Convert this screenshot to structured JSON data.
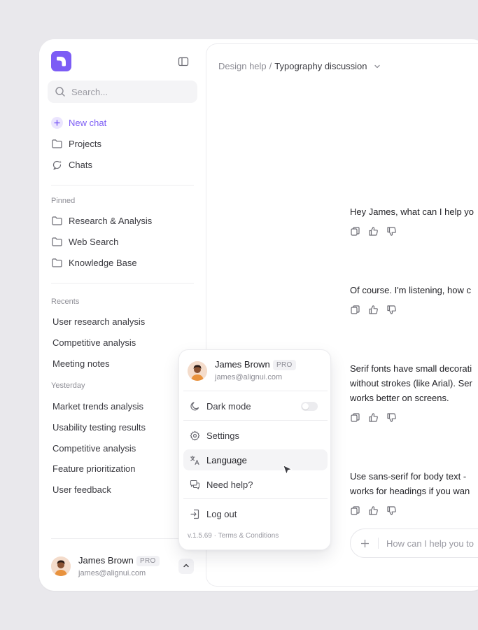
{
  "sidebar": {
    "search_placeholder": "Search...",
    "nav": [
      {
        "label": "New chat",
        "icon": "plus-icon"
      },
      {
        "label": "Projects",
        "icon": "folder-icon"
      },
      {
        "label": "Chats",
        "icon": "chat-icon"
      }
    ],
    "pinned_label": "Pinned",
    "pinned": [
      {
        "label": "Research & Analysis",
        "icon": "folder-icon"
      },
      {
        "label": "Web Search",
        "icon": "folder-icon"
      },
      {
        "label": "Knowledge Base",
        "icon": "folder-icon"
      }
    ],
    "recents_label": "Recents",
    "recents": [
      "User research analysis",
      "Competitive analysis",
      "Meeting notes"
    ],
    "yesterday_label": "Yesterday",
    "yesterday": [
      "Market trends analysis",
      "Usability testing results",
      "Competitive analysis",
      "Feature prioritization",
      "User feedback"
    ],
    "user": {
      "name": "James Brown",
      "badge": "PRO",
      "email": "james@alignui.com"
    }
  },
  "header": {
    "breadcrumb_parent": "Design help",
    "separator": "/",
    "breadcrumb_current": "Typography discussion"
  },
  "messages": [
    {
      "lines": [
        "Hey James, what can I help yo"
      ]
    },
    {
      "lines": [
        "Of course. I'm listening, how c"
      ]
    },
    {
      "lines": [
        "Serif fonts have small decorati",
        "without strokes (like Arial). Ser",
        "works better on screens."
      ]
    },
    {
      "lines": [
        "Use sans-serif for body text -",
        "works for headings if you wan"
      ]
    }
  ],
  "composer": {
    "placeholder": "How can I help you to"
  },
  "user_menu": {
    "user": {
      "name": "James Brown",
      "badge": "PRO",
      "email": "james@alignui.com"
    },
    "dark_mode_label": "Dark mode",
    "dark_mode_on": false,
    "settings_label": "Settings",
    "language_label": "Language",
    "help_label": "Need help?",
    "logout_label": "Log out",
    "version": "v.1.5.69",
    "footer_sep": "·",
    "terms_label": "Terms & Conditions"
  },
  "colors": {
    "accent": "#7c5cf5",
    "accent_soft": "#ebe5fe",
    "background": "#e9e8ec"
  }
}
